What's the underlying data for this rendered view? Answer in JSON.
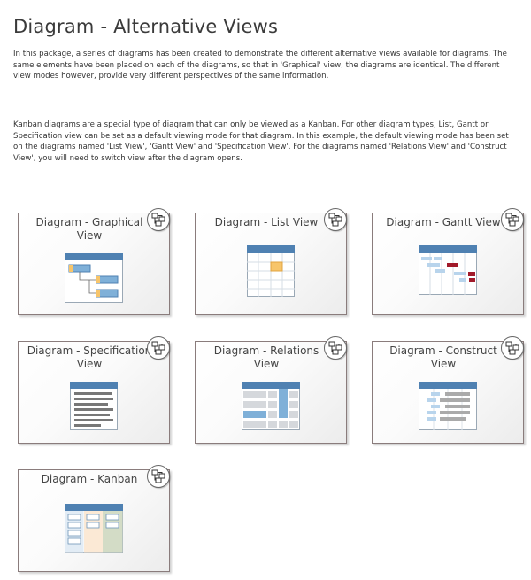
{
  "page": {
    "title": "Diagram - Alternative Views",
    "paragraph1": "In this package, a series of diagrams has been created to demonstrate the different alternative views available for diagrams.  The same elements have been placed on each of the diagrams, so that in 'Graphical' view, the diagrams are identical.  The different view modes however, provide very different perspectives of the same information.",
    "paragraph2": "Kanban diagrams are a special type of diagram that can only be viewed as a Kanban.  For other diagram types, List, Gantt or Specification view can be set as a default viewing mode for that diagram.  In this example, the default viewing mode has been set on the diagrams named 'List View', 'Gantt View' and 'Specification View'.  For the diagrams named 'Relations View' and 'Construct View', you will need to switch view after the diagram opens."
  },
  "tiles": [
    {
      "label": "Diagram - Graphical View",
      "icon": "graphical-view-icon"
    },
    {
      "label": "Diagram - List View",
      "icon": "list-view-icon"
    },
    {
      "label": "Diagram - Gantt View",
      "icon": "gantt-view-icon"
    },
    {
      "label": "Diagram - Specification View",
      "icon": "specification-view-icon"
    },
    {
      "label": "Diagram - Relations View",
      "icon": "relations-view-icon"
    },
    {
      "label": "Diagram - Construct View",
      "icon": "construct-view-icon"
    },
    {
      "label": "Diagram - Kanban",
      "icon": "kanban-view-icon"
    }
  ],
  "badge_icon": "diagram-link-icon",
  "colors": {
    "header_blue": "#4f81b2",
    "highlight_blue": "#7fb0d8",
    "gantt_red": "#a11a2a",
    "orange_cell": "#f7c56b"
  }
}
